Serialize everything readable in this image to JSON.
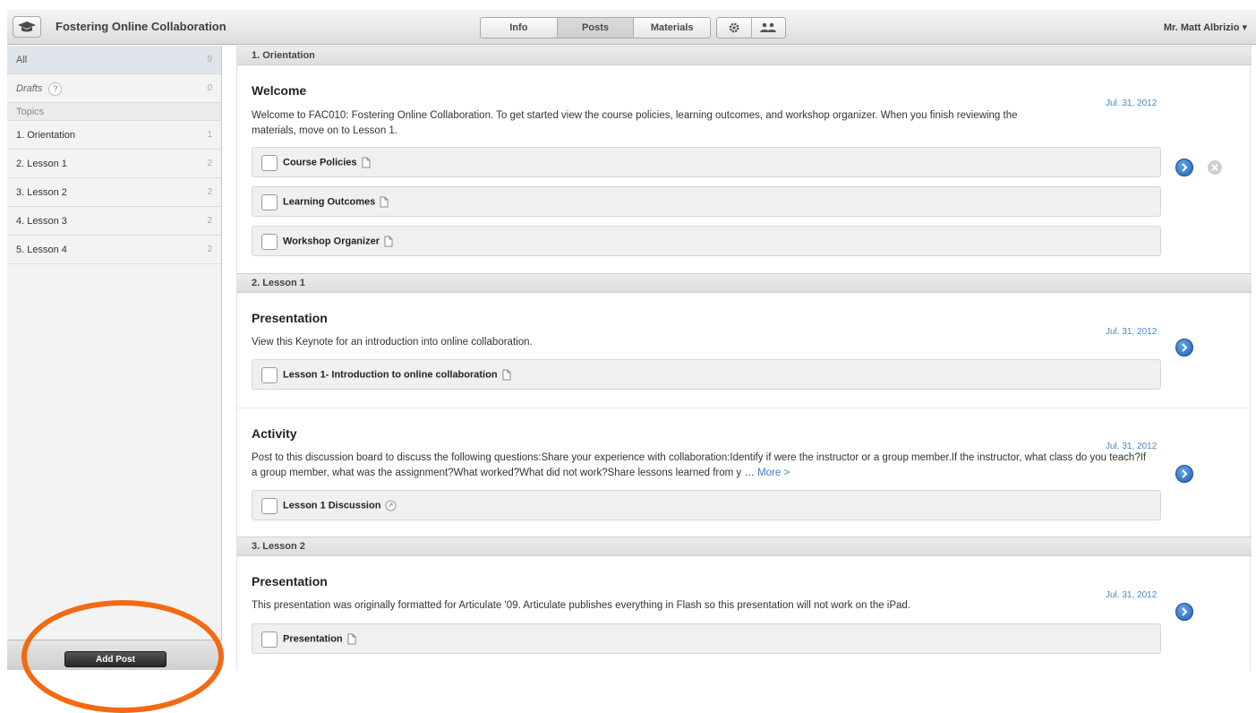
{
  "header": {
    "course_title": "Fostering Online Collaboration",
    "tabs": [
      {
        "label": "Info"
      },
      {
        "label": "Posts"
      },
      {
        "label": "Materials"
      }
    ],
    "user": "Mr. Matt Albrizio ▾"
  },
  "sidebar": {
    "all": {
      "label": "All",
      "count": "9"
    },
    "drafts": {
      "label": "Drafts",
      "help": "?",
      "count": "0"
    },
    "topics_heading": "Topics",
    "topics": [
      {
        "label": "1. Orientation",
        "count": "1"
      },
      {
        "label": "2. Lesson 1",
        "count": "2"
      },
      {
        "label": "3. Lesson 2",
        "count": "2"
      },
      {
        "label": "4. Lesson 3",
        "count": "2"
      },
      {
        "label": "5. Lesson 4",
        "count": "2"
      }
    ],
    "add_post": "Add Post"
  },
  "sections": [
    {
      "title": "1. Orientation",
      "posts": [
        {
          "title": "Welcome",
          "date": "Jul. 31, 2012",
          "description": "Welcome to FAC010: Fostering Online Collaboration. To get started view the course policies, learning outcomes, and workshop organizer. When you finish reviewing the materials, move on to Lesson 1.",
          "materials": [
            "Course Policies",
            "Learning Outcomes",
            "Workshop Organizer"
          ]
        }
      ]
    },
    {
      "title": "2. Lesson 1",
      "posts": [
        {
          "title": "Presentation",
          "date": "Jul. 31, 2012",
          "description": "View this Keynote for an introduction into online collaboration.",
          "materials": [
            "Lesson 1- Introduction to online collaboration"
          ]
        },
        {
          "title": "Activity",
          "date": "Jul. 31, 2012",
          "description": "Post to this discussion board to discuss the following questions:Share your experience with collaboration:Identify if were the instructor or a group member.If the instructor, what class do you teach?If a group member, what was the assignment?What worked?What did not work?Share lessons learned from y …",
          "more": "More >",
          "materials": [
            "Lesson 1 Discussion"
          ]
        }
      ]
    },
    {
      "title": "3. Lesson 2",
      "posts": [
        {
          "title": "Presentation",
          "date": "Jul. 31, 2012",
          "description": "This presentation was originally formatted for Articulate '09. Articulate publishes everything in Flash so this presentation will not work on the iPad.",
          "materials": [
            "Presentation"
          ]
        }
      ]
    }
  ],
  "colors": {
    "accent_blue": "#1f5fb0",
    "date_blue": "#4a86c5",
    "highlight_orange": "#f26a12"
  }
}
